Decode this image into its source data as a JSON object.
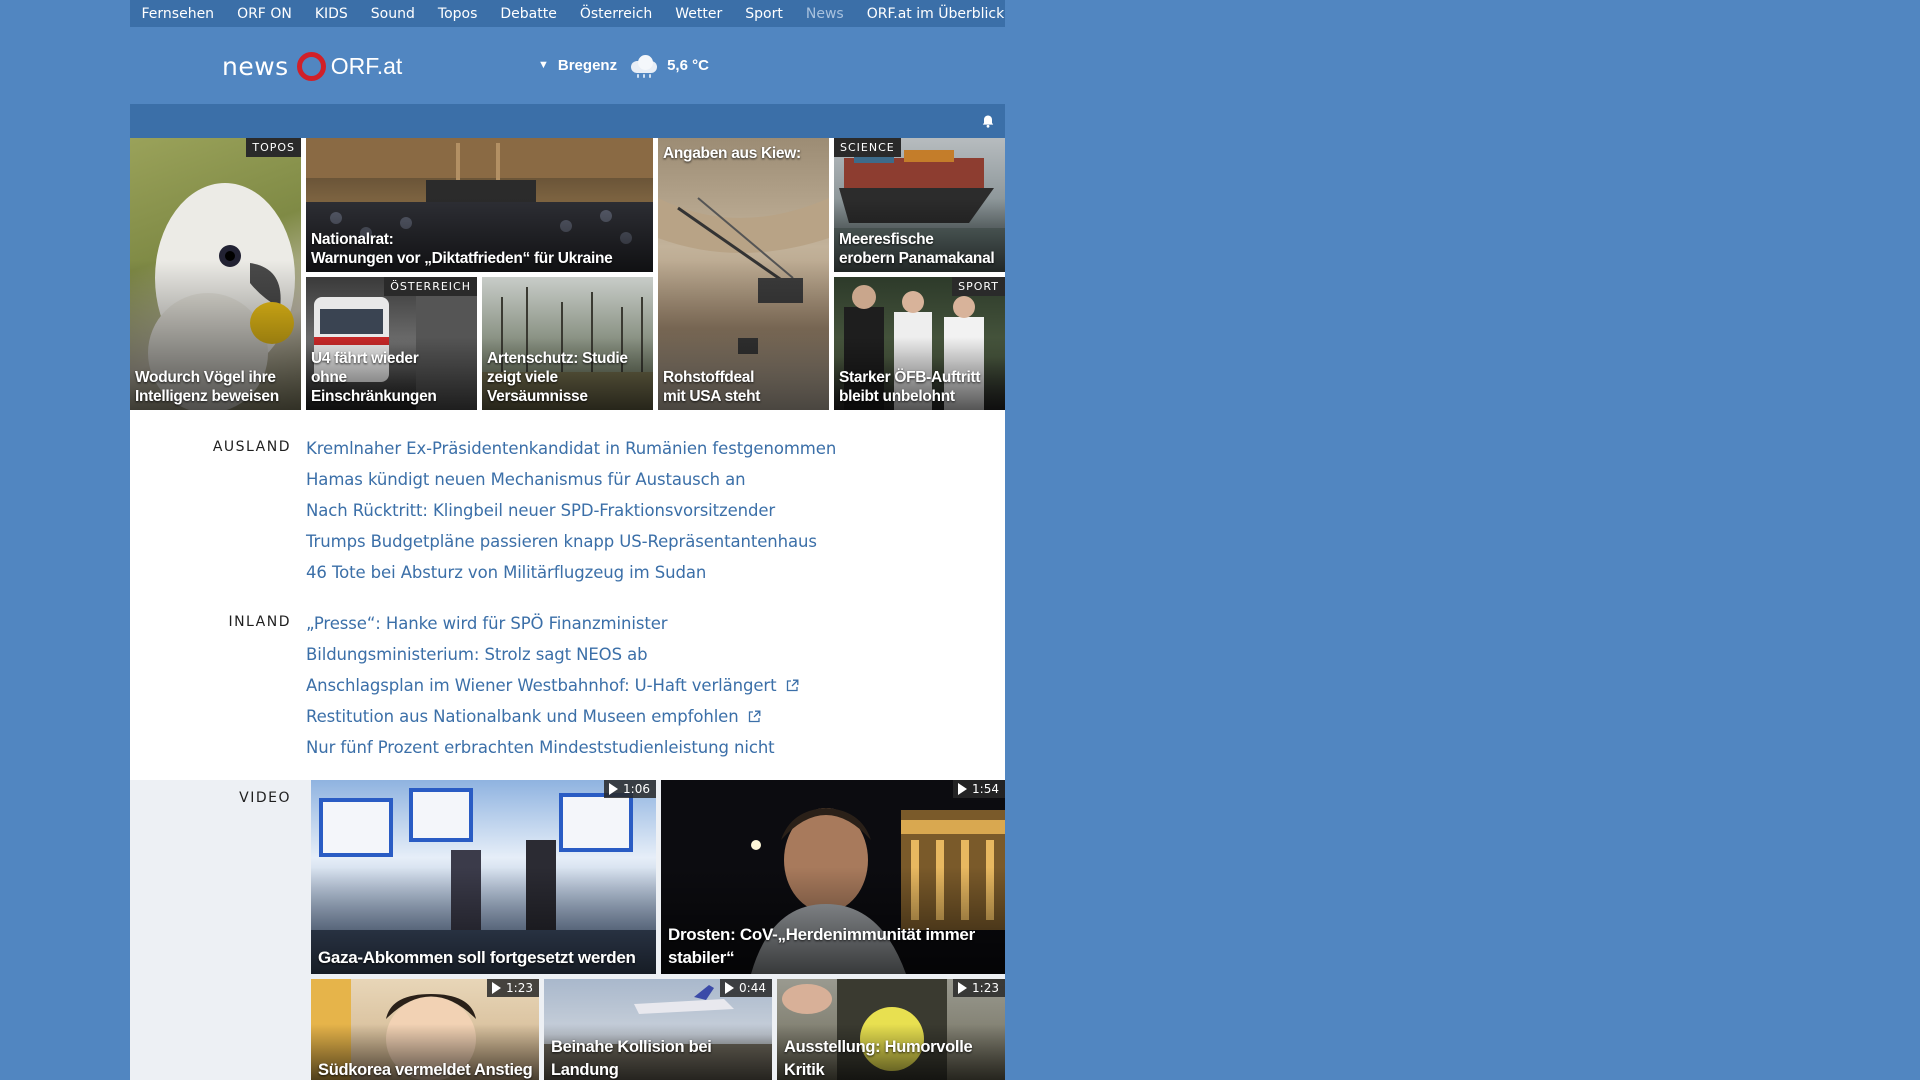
{
  "topnav": {
    "items": [
      "Fernsehen",
      "ORF ON",
      "KIDS",
      "Sound",
      "Topos",
      "Debatte",
      "Österreich",
      "Wetter",
      "Sport",
      "News"
    ],
    "overview": "ORF.at im Überblick"
  },
  "logo": {
    "news": "news",
    "orf": "ORF.at"
  },
  "weather": {
    "city": "Bregenz",
    "temp": "5,6 °C",
    "icon": "cloud-rain-icon"
  },
  "tiles": [
    {
      "title_line1": "Wodurch Vögel ihre",
      "title_line2": "Intelligenz beweisen",
      "tag": "TOPOS"
    },
    {
      "title_line1": "Nationalrat:",
      "title_line2": "Warnungen vor „Diktatfrieden“ für Ukraine"
    },
    {
      "title_line1": "Angaben aus Kiew:",
      "title_line2": "Rohstoffdeal",
      "title_line3": "mit USA steht"
    },
    {
      "title_line1": "Meeresfische",
      "title_line2": "erobern Panamakanal",
      "tag": "SCIENCE"
    },
    {
      "title_line1": "U4 fährt wieder",
      "title_line2": "ohne Einschränkungen",
      "tag": "ÖSTERREICH"
    },
    {
      "title_line1": "Artenschutz: Studie",
      "title_line2": "zeigt viele Versäumnisse"
    },
    {
      "title_line1": "Starker ÖFB-Auftritt",
      "title_line2": "bleibt unbelohnt",
      "tag": "SPORT"
    }
  ],
  "sections": {
    "ausland": {
      "label": "AUSLAND",
      "items": [
        "Kremlnaher Ex-Präsidentenkandidat in Rumänien festgenommen",
        "Hamas kündigt neuen Mechanismus für Austausch an",
        "Nach Rücktritt: Klingbeil neuer SPD-Fraktionsvorsitzender",
        "Trumps Budgetpläne passieren knapp US-Repräsentantenhaus",
        "46 Tote bei Absturz von Militärflugzeug im Sudan"
      ]
    },
    "inland": {
      "label": "INLAND",
      "items": [
        "„Presse“: Hanke wird für SPÖ Finanzminister",
        "Bildungsministerium: Strolz sagt NEOS ab",
        "Anschlagsplan im Wiener Westbahnhof: U-Haft verlängert",
        "Restitution aus Nationalbank und Museen empfohlen",
        "Nur fünf Prozent erbrachten Mindeststudienleistung nicht"
      ],
      "external": [
        false,
        false,
        true,
        true,
        false
      ]
    },
    "video": {
      "label": "VIDEO",
      "items": [
        {
          "title": "Gaza-Abkommen soll fortgesetzt werden",
          "duration": "1:06"
        },
        {
          "title_line1": "Drosten: CoV-„Herdenimmunität immer",
          "title_line2": "stabiler“",
          "duration": "1:54"
        },
        {
          "title": "Südkorea vermeldet Anstieg",
          "duration": "1:23"
        },
        {
          "title": "Beinahe Kollision bei Landung",
          "duration": "0:44"
        },
        {
          "title": "Ausstellung: Humorvolle Kritik",
          "duration": "1:23"
        }
      ]
    }
  },
  "colors": {
    "page_bg": "#5186c1",
    "nav_bg": "#3b6fa8",
    "link": "#3b6fa8",
    "logo_red": "#d12028",
    "video_bg": "#edf0f4"
  }
}
